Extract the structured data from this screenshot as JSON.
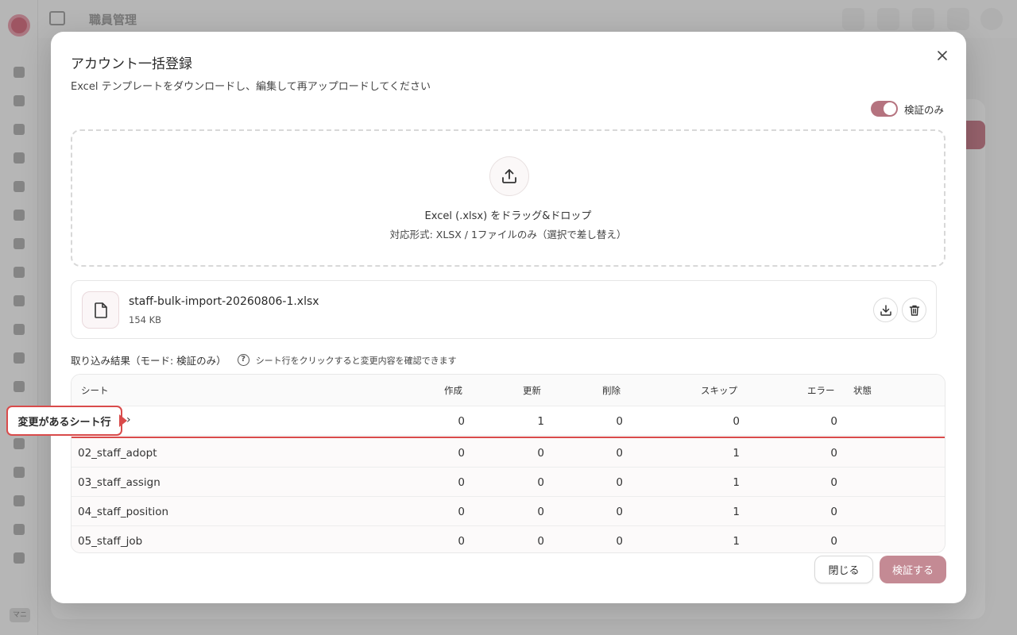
{
  "app": {
    "page_title": "職員管理",
    "sidebar_bottom": "マニ"
  },
  "modal": {
    "title": "アカウント一括登録",
    "description": "Excel テンプレートをダウンロードし、編集して再アップロードしてください",
    "validate_only_label": "検証のみ",
    "validate_only_on": true,
    "dropzone": {
      "main": "Excel (.xlsx) をドラッグ&ドロップ",
      "sub": "対応形式: XLSX / 1ファイルのみ（選択で差し替え）"
    },
    "file": {
      "name": "staff-bulk-import-20260806-1.xlsx",
      "size": "154 KB"
    },
    "result": {
      "heading": "取り込み結果（モード: 検証のみ）",
      "hint": "シート行をクリックすると変更内容を確認できます",
      "columns": [
        "シート",
        "作成",
        "更新",
        "削除",
        "スキップ",
        "エラー",
        "状態"
      ],
      "rows": [
        {
          "sheet": "",
          "create": "0",
          "update": "1",
          "delete": "0",
          "skip": "0",
          "error": "0",
          "status": ""
        },
        {
          "sheet": "02_staff_adopt",
          "create": "0",
          "update": "0",
          "delete": "0",
          "skip": "1",
          "error": "0",
          "status": ""
        },
        {
          "sheet": "03_staff_assign",
          "create": "0",
          "update": "0",
          "delete": "0",
          "skip": "1",
          "error": "0",
          "status": ""
        },
        {
          "sheet": "04_staff_position",
          "create": "0",
          "update": "0",
          "delete": "0",
          "skip": "1",
          "error": "0",
          "status": ""
        },
        {
          "sheet": "05_staff_job",
          "create": "0",
          "update": "0",
          "delete": "0",
          "skip": "1",
          "error": "0",
          "status": ""
        }
      ]
    },
    "callout": "変更があるシート行",
    "buttons": {
      "close": "閉じる",
      "verify": "検証する"
    },
    "colors": {
      "accent": "#c48a94",
      "toggle": "#b5737f",
      "highlight": "#d94b4b"
    }
  }
}
